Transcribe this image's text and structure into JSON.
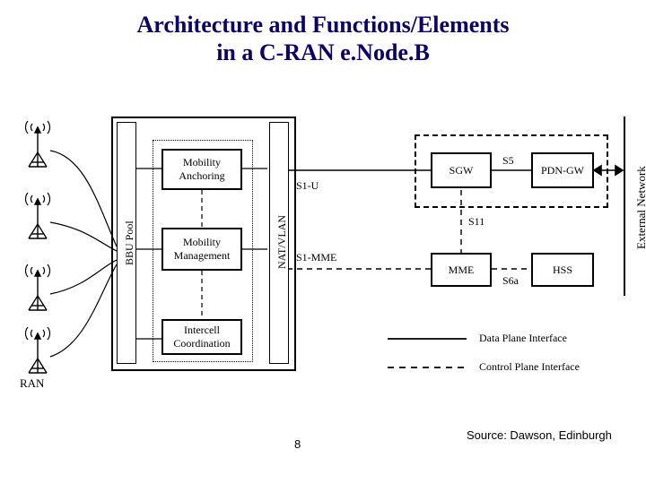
{
  "title_line1": "Architecture and Functions/Elements",
  "title_line2": "in a C-RAN e.Node.B",
  "ran_label": "RAN",
  "bars": {
    "bbu": "BBU Pool",
    "nat": "NAT/VLAN"
  },
  "inner": {
    "mobility_anchoring": "Mobility\nAnchoring",
    "mobility_management": "Mobility\nManagement",
    "intercell": "Intercell\nCoordination"
  },
  "core": {
    "sgw": "SGW",
    "pdn": "PDN-GW",
    "mme": "MME",
    "hss": "HSS"
  },
  "links": {
    "s1u": "S1-U",
    "s1mme": "S1-MME",
    "s5": "S5",
    "s11": "S11",
    "s6a": "S6a"
  },
  "ext": "External Network",
  "legend": {
    "data": "Data Plane Interface",
    "control": "Control Plane Interface"
  },
  "page": "8",
  "source": "Source: Dawson, Edinburgh"
}
